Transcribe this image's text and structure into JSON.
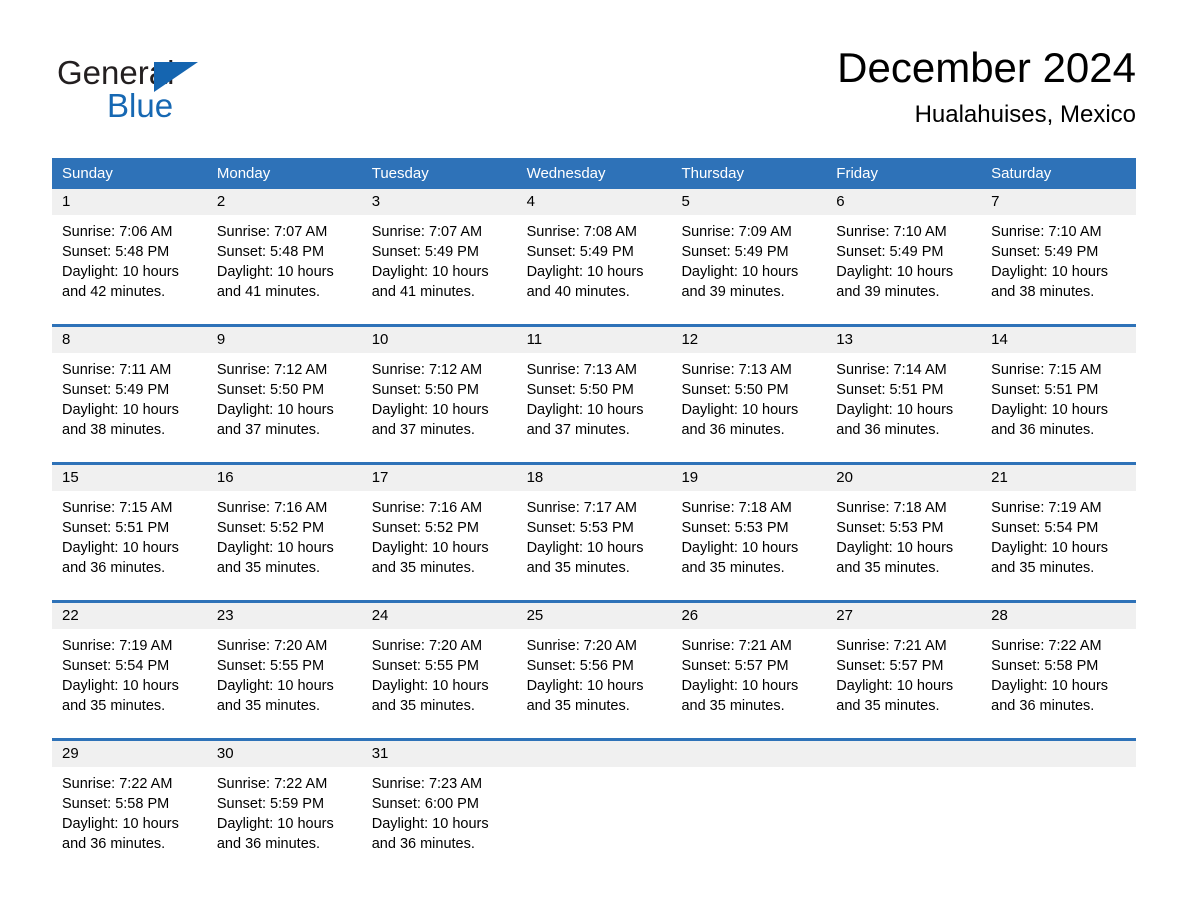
{
  "brand": {
    "name_part1": "General",
    "name_part2": "Blue",
    "triangle_color": "#1565b0",
    "text_color": "#231f20",
    "blue_color": "#1668b3"
  },
  "header": {
    "month_title": "December 2024",
    "location": "Hualahuises, Mexico"
  },
  "theme": {
    "header_blue": "#2e72b8",
    "date_strip_gray": "#f0f0f0",
    "text_black": "#000000"
  },
  "weekdays": [
    "Sunday",
    "Monday",
    "Tuesday",
    "Wednesday",
    "Thursday",
    "Friday",
    "Saturday"
  ],
  "weeks": [
    [
      {
        "date": "1",
        "sunrise": "Sunrise: 7:06 AM",
        "sunset": "Sunset: 5:48 PM",
        "daylight": "Daylight: 10 hours and 42 minutes."
      },
      {
        "date": "2",
        "sunrise": "Sunrise: 7:07 AM",
        "sunset": "Sunset: 5:48 PM",
        "daylight": "Daylight: 10 hours and 41 minutes."
      },
      {
        "date": "3",
        "sunrise": "Sunrise: 7:07 AM",
        "sunset": "Sunset: 5:49 PM",
        "daylight": "Daylight: 10 hours and 41 minutes."
      },
      {
        "date": "4",
        "sunrise": "Sunrise: 7:08 AM",
        "sunset": "Sunset: 5:49 PM",
        "daylight": "Daylight: 10 hours and 40 minutes."
      },
      {
        "date": "5",
        "sunrise": "Sunrise: 7:09 AM",
        "sunset": "Sunset: 5:49 PM",
        "daylight": "Daylight: 10 hours and 39 minutes."
      },
      {
        "date": "6",
        "sunrise": "Sunrise: 7:10 AM",
        "sunset": "Sunset: 5:49 PM",
        "daylight": "Daylight: 10 hours and 39 minutes."
      },
      {
        "date": "7",
        "sunrise": "Sunrise: 7:10 AM",
        "sunset": "Sunset: 5:49 PM",
        "daylight": "Daylight: 10 hours and 38 minutes."
      }
    ],
    [
      {
        "date": "8",
        "sunrise": "Sunrise: 7:11 AM",
        "sunset": "Sunset: 5:49 PM",
        "daylight": "Daylight: 10 hours and 38 minutes."
      },
      {
        "date": "9",
        "sunrise": "Sunrise: 7:12 AM",
        "sunset": "Sunset: 5:50 PM",
        "daylight": "Daylight: 10 hours and 37 minutes."
      },
      {
        "date": "10",
        "sunrise": "Sunrise: 7:12 AM",
        "sunset": "Sunset: 5:50 PM",
        "daylight": "Daylight: 10 hours and 37 minutes."
      },
      {
        "date": "11",
        "sunrise": "Sunrise: 7:13 AM",
        "sunset": "Sunset: 5:50 PM",
        "daylight": "Daylight: 10 hours and 37 minutes."
      },
      {
        "date": "12",
        "sunrise": "Sunrise: 7:13 AM",
        "sunset": "Sunset: 5:50 PM",
        "daylight": "Daylight: 10 hours and 36 minutes."
      },
      {
        "date": "13",
        "sunrise": "Sunrise: 7:14 AM",
        "sunset": "Sunset: 5:51 PM",
        "daylight": "Daylight: 10 hours and 36 minutes."
      },
      {
        "date": "14",
        "sunrise": "Sunrise: 7:15 AM",
        "sunset": "Sunset: 5:51 PM",
        "daylight": "Daylight: 10 hours and 36 minutes."
      }
    ],
    [
      {
        "date": "15",
        "sunrise": "Sunrise: 7:15 AM",
        "sunset": "Sunset: 5:51 PM",
        "daylight": "Daylight: 10 hours and 36 minutes."
      },
      {
        "date": "16",
        "sunrise": "Sunrise: 7:16 AM",
        "sunset": "Sunset: 5:52 PM",
        "daylight": "Daylight: 10 hours and 35 minutes."
      },
      {
        "date": "17",
        "sunrise": "Sunrise: 7:16 AM",
        "sunset": "Sunset: 5:52 PM",
        "daylight": "Daylight: 10 hours and 35 minutes."
      },
      {
        "date": "18",
        "sunrise": "Sunrise: 7:17 AM",
        "sunset": "Sunset: 5:53 PM",
        "daylight": "Daylight: 10 hours and 35 minutes."
      },
      {
        "date": "19",
        "sunrise": "Sunrise: 7:18 AM",
        "sunset": "Sunset: 5:53 PM",
        "daylight": "Daylight: 10 hours and 35 minutes."
      },
      {
        "date": "20",
        "sunrise": "Sunrise: 7:18 AM",
        "sunset": "Sunset: 5:53 PM",
        "daylight": "Daylight: 10 hours and 35 minutes."
      },
      {
        "date": "21",
        "sunrise": "Sunrise: 7:19 AM",
        "sunset": "Sunset: 5:54 PM",
        "daylight": "Daylight: 10 hours and 35 minutes."
      }
    ],
    [
      {
        "date": "22",
        "sunrise": "Sunrise: 7:19 AM",
        "sunset": "Sunset: 5:54 PM",
        "daylight": "Daylight: 10 hours and 35 minutes."
      },
      {
        "date": "23",
        "sunrise": "Sunrise: 7:20 AM",
        "sunset": "Sunset: 5:55 PM",
        "daylight": "Daylight: 10 hours and 35 minutes."
      },
      {
        "date": "24",
        "sunrise": "Sunrise: 7:20 AM",
        "sunset": "Sunset: 5:55 PM",
        "daylight": "Daylight: 10 hours and 35 minutes."
      },
      {
        "date": "25",
        "sunrise": "Sunrise: 7:20 AM",
        "sunset": "Sunset: 5:56 PM",
        "daylight": "Daylight: 10 hours and 35 minutes."
      },
      {
        "date": "26",
        "sunrise": "Sunrise: 7:21 AM",
        "sunset": "Sunset: 5:57 PM",
        "daylight": "Daylight: 10 hours and 35 minutes."
      },
      {
        "date": "27",
        "sunrise": "Sunrise: 7:21 AM",
        "sunset": "Sunset: 5:57 PM",
        "daylight": "Daylight: 10 hours and 35 minutes."
      },
      {
        "date": "28",
        "sunrise": "Sunrise: 7:22 AM",
        "sunset": "Sunset: 5:58 PM",
        "daylight": "Daylight: 10 hours and 36 minutes."
      }
    ],
    [
      {
        "date": "29",
        "sunrise": "Sunrise: 7:22 AM",
        "sunset": "Sunset: 5:58 PM",
        "daylight": "Daylight: 10 hours and 36 minutes."
      },
      {
        "date": "30",
        "sunrise": "Sunrise: 7:22 AM",
        "sunset": "Sunset: 5:59 PM",
        "daylight": "Daylight: 10 hours and 36 minutes."
      },
      {
        "date": "31",
        "sunrise": "Sunrise: 7:23 AM",
        "sunset": "Sunset: 6:00 PM",
        "daylight": "Daylight: 10 hours and 36 minutes."
      },
      {
        "date": "",
        "sunrise": "",
        "sunset": "",
        "daylight": ""
      },
      {
        "date": "",
        "sunrise": "",
        "sunset": "",
        "daylight": ""
      },
      {
        "date": "",
        "sunrise": "",
        "sunset": "",
        "daylight": ""
      },
      {
        "date": "",
        "sunrise": "",
        "sunset": "",
        "daylight": ""
      }
    ]
  ]
}
